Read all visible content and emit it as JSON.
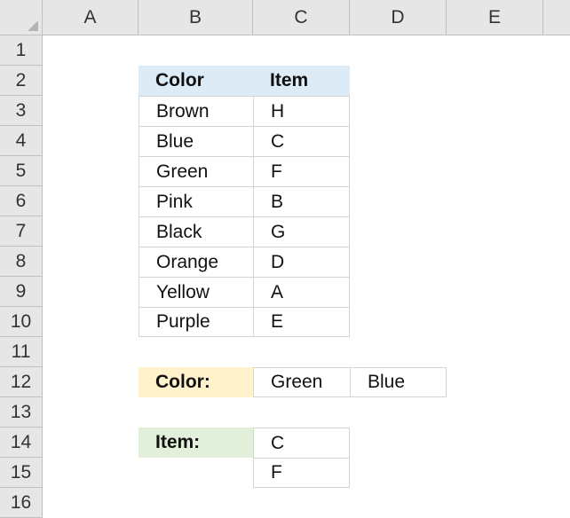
{
  "columns": [
    "A",
    "B",
    "C",
    "D",
    "E"
  ],
  "rows": [
    "1",
    "2",
    "3",
    "4",
    "5",
    "6",
    "7",
    "8",
    "9",
    "10",
    "11",
    "12",
    "13",
    "14",
    "15",
    "16"
  ],
  "table": {
    "headers": [
      "Color",
      "Item"
    ],
    "rows": [
      [
        "Brown",
        "H"
      ],
      [
        "Blue",
        "C"
      ],
      [
        "Green",
        "F"
      ],
      [
        "Pink",
        "B"
      ],
      [
        "Black",
        "G"
      ],
      [
        "Orange",
        "D"
      ],
      [
        "Yellow",
        "A"
      ],
      [
        "Purple",
        "E"
      ]
    ]
  },
  "color_criteria": {
    "label": "Color:",
    "values": [
      "Green",
      "Blue"
    ]
  },
  "item_result": {
    "label": "Item:",
    "values": [
      "C",
      "F"
    ]
  },
  "colors": {
    "header_blue": "#ddebf7",
    "label_yellow": "#fff2cc",
    "label_green": "#e2efda",
    "gridline": "#d4d4d4",
    "header_strip": "#e6e6e6"
  }
}
